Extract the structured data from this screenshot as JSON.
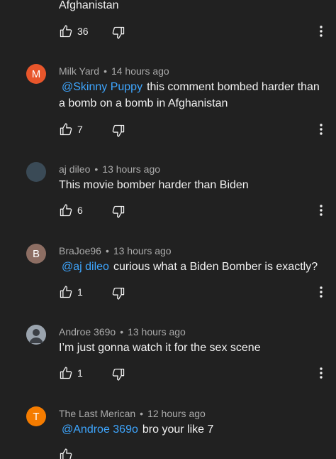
{
  "comments": [
    {
      "text_tail": "Afghanistan",
      "likes": "36",
      "colors": {}
    },
    {
      "author": "Milk Yard",
      "time": "14 hours ago",
      "avatar_letter": "M",
      "avatar_color": "#e8562b",
      "mention": "@Skinny Puppy",
      "text": "this comment bombed harder than a bomb on a bomb in Afghanistan",
      "likes": "7"
    },
    {
      "author": "aj dileo",
      "time": "13 hours ago",
      "avatar_color": "#3a4a56",
      "text": "This movie bomber harder than Biden",
      "likes": "6"
    },
    {
      "author": "BraJoe96",
      "time": "13 hours ago",
      "avatar_letter": "B",
      "avatar_color": "#8d6e63",
      "mention": "@aj dileo",
      "text": "curious what a Biden Bomber is exactly?",
      "likes": "1"
    },
    {
      "author": "Androe 369o",
      "time": "13 hours ago",
      "avatar_color": "#5b6470",
      "text": "I’m just gonna watch it for the sex scene",
      "likes": "1"
    },
    {
      "author": "The Last Merican",
      "time": "12 hours ago",
      "avatar_letter": "T",
      "avatar_color": "#f57c00",
      "mention": "@Androe 369o",
      "text": "bro your like 7"
    }
  ],
  "meta_separator": "•",
  "icons": {
    "like": "thumb-up-icon",
    "dislike": "thumb-down-icon",
    "more": "more-vertical-icon"
  },
  "colors": {
    "background": "#212121",
    "text": "#f1f1f1",
    "meta": "#aaaaaa",
    "mention": "#3ea6ff"
  }
}
